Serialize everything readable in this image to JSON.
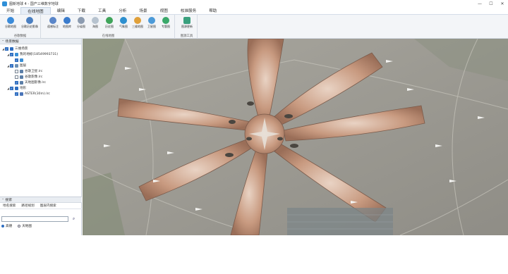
{
  "window": {
    "title": "图新地球 4 - 国产三维数字地球",
    "minimize": "—",
    "maximize": "☐",
    "close": "✕"
  },
  "menu": {
    "tabs": [
      "开始",
      "在线地图",
      "编辑",
      "下载",
      "工具",
      "分析",
      "场景",
      "视图",
      "校准服务",
      "帮助"
    ]
  },
  "ribbon": {
    "groups": [
      {
        "label": "谷歌数据",
        "buttons": [
          "谷歌地图",
          "谷歌历史影像"
        ]
      },
      {
        "label": "在线地图",
        "buttons": [
          "遥感标注",
          "地图库",
          "分省图",
          "海图",
          "历史图",
          "气象图",
          "三维地图",
          "卫星图",
          "专题图"
        ]
      },
      {
        "label": "图源工具",
        "buttons": [
          "图源更新"
        ]
      }
    ]
  },
  "scene_panel": {
    "header": "场景数据",
    "items": [
      {
        "label": "三维场景",
        "level": 0,
        "checked": true,
        "expanded": true
      },
      {
        "label": "我的地标(18549993731)",
        "level": 1,
        "checked": true,
        "expanded": true
      },
      {
        "label": "",
        "level": 2,
        "checked": true,
        "expanded": false
      },
      {
        "label": "图层",
        "level": 1,
        "checked": true,
        "expanded": true
      },
      {
        "label": "谷歌卫星.lrc",
        "level": 2,
        "checked": false,
        "expanded": false
      },
      {
        "label": "谷歌影像.lrc",
        "level": 2,
        "checked": false,
        "expanded": false
      },
      {
        "label": "天地图影像.lrc",
        "level": 2,
        "checked": true,
        "expanded": false
      },
      {
        "label": "地形",
        "level": 1,
        "checked": true,
        "expanded": true
      },
      {
        "label": "ASTER(30m).lrc",
        "level": 2,
        "checked": true,
        "expanded": false
      }
    ]
  },
  "search_panel": {
    "header": "搜索",
    "tabs": [
      "地名搜索",
      "路径规划",
      "图层内搜索"
    ],
    "input_value": "",
    "options": [
      {
        "label": "高德",
        "selected": true
      },
      {
        "label": "天地图",
        "selected": false
      }
    ]
  }
}
